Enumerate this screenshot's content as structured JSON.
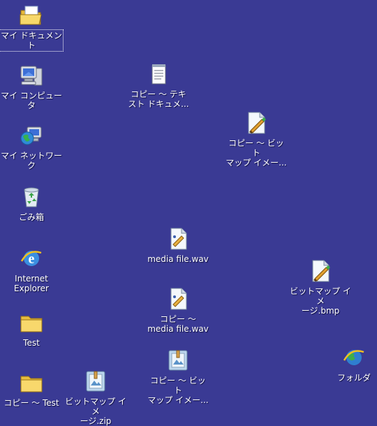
{
  "desktop": {
    "background_color": "#3a3a94",
    "icons": [
      {
        "name": "mydocuments",
        "label": "マイ ドキュメント",
        "icon": "open-folder-icon",
        "selected": true
      },
      {
        "name": "mycomputer",
        "label": "マイ コンピュータ",
        "icon": "computer-icon"
      },
      {
        "name": "network",
        "label": "マイ ネットワーク",
        "icon": "network-globe-icon"
      },
      {
        "name": "recyclebin",
        "label": "ごみ箱",
        "icon": "recycle-bin-icon"
      },
      {
        "name": "ie",
        "label": "Internet\nExplorer",
        "icon": "internet-explorer-icon"
      },
      {
        "name": "test-folder",
        "label": "Test",
        "icon": "folder-icon"
      },
      {
        "name": "copy-test-folder",
        "label": "コピー ～ Test",
        "icon": "folder-icon"
      },
      {
        "name": "bitmap-zip",
        "label": "ビットマップ イメ\nージ.zip",
        "icon": "zip-archive-icon"
      },
      {
        "name": "copy-text-doc",
        "label": "コピー ～ テキ\nスト ドキュメ...",
        "icon": "text-document-icon"
      },
      {
        "name": "copy-bitmap-1",
        "label": "コピー ～ ビット\nマップ イメー...",
        "icon": "bitmap-image-icon"
      },
      {
        "name": "media-wav",
        "label": "media file.wav",
        "icon": "audio-file-icon"
      },
      {
        "name": "copy-media-wav",
        "label": "コピー ～\nmedia file.wav",
        "icon": "audio-file-icon"
      },
      {
        "name": "copy-bitmap-zip",
        "label": "コピー ～ ビット\nマップ イメー...",
        "icon": "zip-archive-icon"
      },
      {
        "name": "bitmap-bmp",
        "label": "ビットマップ イメ\nージ.bmp",
        "icon": "bitmap-image-icon"
      },
      {
        "name": "folder-ie",
        "label": "フォルダ",
        "icon": "internet-explorer-icon"
      }
    ]
  }
}
